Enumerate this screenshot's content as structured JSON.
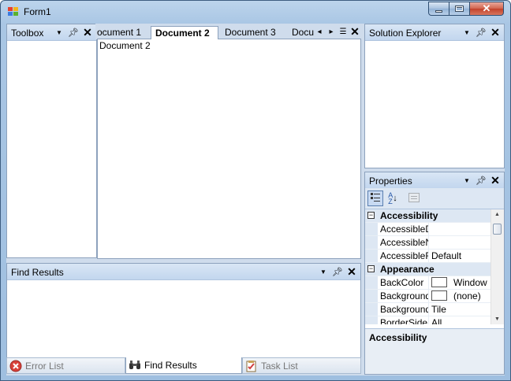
{
  "window": {
    "title": "Form1"
  },
  "toolbox": {
    "title": "Toolbox"
  },
  "documents": {
    "tabs": [
      {
        "label": "ocument 1"
      },
      {
        "label": "Document 2"
      },
      {
        "label": "Document 3"
      },
      {
        "label": "Docu"
      }
    ],
    "active_index": 1,
    "content": "Document 2"
  },
  "solution_explorer": {
    "title": "Solution Explorer"
  },
  "properties": {
    "title": "Properties",
    "toolbar_icons": [
      "categorized-icon",
      "alphabetical-icon",
      "property-pages-icon"
    ],
    "rows": [
      {
        "type": "category",
        "toggle": "−",
        "name": "Accessibility"
      },
      {
        "type": "property",
        "name": "AccessibleDe",
        "value": ""
      },
      {
        "type": "property",
        "name": "AccessibleNa",
        "value": ""
      },
      {
        "type": "property",
        "name": "AccessibleRo",
        "value": "Default"
      },
      {
        "type": "category",
        "toggle": "−",
        "name": "Appearance"
      },
      {
        "type": "property",
        "name": "BackColor",
        "value": "Window",
        "swatch": true
      },
      {
        "type": "property",
        "name": "BackgroundIm",
        "value": "(none)",
        "swatch": true
      },
      {
        "type": "property",
        "name": "BackgroundIm",
        "value": "Tile"
      },
      {
        "type": "property",
        "name": "BorderSide",
        "value": "All"
      }
    ],
    "description_title": "Accessibility"
  },
  "find_results": {
    "title": "Find Results"
  },
  "bottom_tabs": [
    {
      "label": "Error List",
      "icon": "error-icon",
      "active": false
    },
    {
      "label": "Find Results",
      "icon": "binoculars-icon",
      "active": true
    },
    {
      "label": "Task List",
      "icon": "task-list-icon",
      "active": false
    }
  ],
  "colors": {
    "panel_header": "#c2d6ee",
    "border": "#8da2bd",
    "close_button": "#c2412a"
  }
}
